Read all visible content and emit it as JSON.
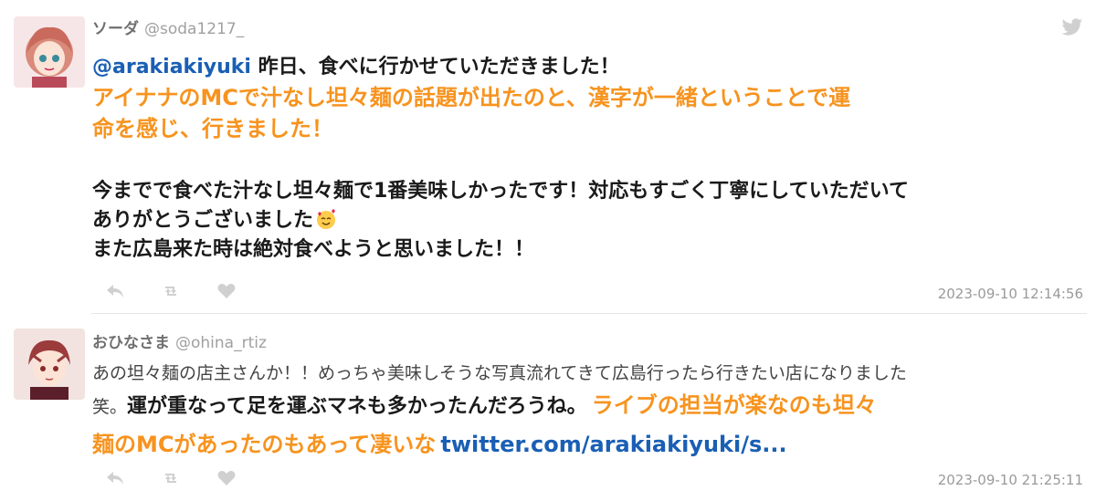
{
  "tweets": [
    {
      "display_name": "ソーダ",
      "handle": "@soda1217_",
      "mention": "@arakiakiyuki",
      "line1_rest": " 昨日、食べに行かせていただきました！",
      "highlight_line1": "アイナナのMCで汁なし坦々麺の話題が出たのと、漢字が一緒ということで運",
      "highlight_line2": "命を感じ、行きました！",
      "body_line1": "今までで食べた汁なし坦々麺で1番美味しかったです！対応もすごく丁寧にしていただいて",
      "body_line2": "ありがとうございました",
      "body_emoji": "smiling-face-with-hearts-emoji",
      "body_line3": "また広島来た時は絶対食べようと思いました！！",
      "timestamp": "2023-09-10 12:14:56"
    },
    {
      "display_name": "おひなさま",
      "handle": "@ohina_rtiz",
      "line1": "あの坦々麺の店主さんか！！めっちゃ美味しそうな写真流れてきて広島行ったら行きたい店になりました",
      "line2_small": "笑。",
      "line2_bold": "運が重なって足を運ぶマネも多かったんだろうね。",
      "line2_orange": "ライブの担当が楽なのも坦々",
      "line3_orange": "麺のMCがあったのもあって凄いな",
      "link": "twitter.com/arakiakiyuki/s...",
      "timestamp": "2023-09-10 21:25:11"
    }
  ],
  "icons": [
    "twitter-bird-icon",
    "reply-icon",
    "retweet-icon",
    "like-icon",
    "avatar"
  ],
  "colors": {
    "accent_orange": "#f7931e",
    "link_blue": "#1a5fb4",
    "muted_gray": "#9a9a9a"
  }
}
